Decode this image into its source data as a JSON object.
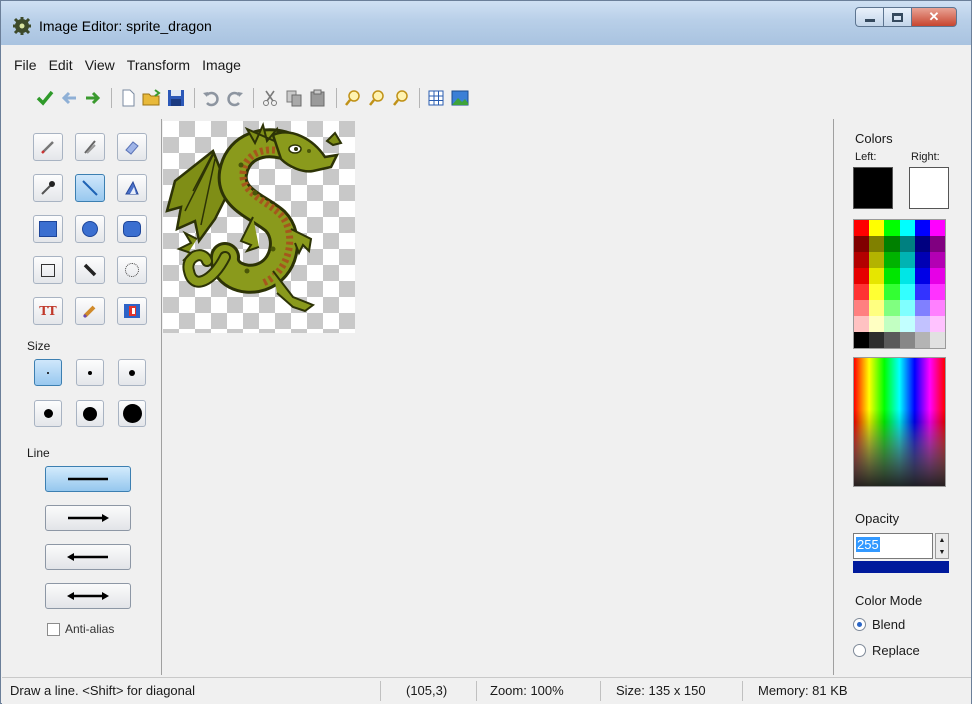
{
  "window": {
    "title": "Image Editor: sprite_dragon",
    "close_label": "✕"
  },
  "menu": [
    "File",
    "Edit",
    "View",
    "Transform",
    "Image"
  ],
  "toolbar": {
    "icons": [
      "ok-icon",
      "back-icon",
      "forward-icon",
      "new-icon",
      "open-icon",
      "save-icon",
      "undo-icon",
      "redo-icon",
      "cut-icon",
      "copy-icon",
      "paste-icon",
      "zoom-in-icon",
      "zoom-out-icon",
      "zoom-fit-icon",
      "grid-icon",
      "image-icon"
    ]
  },
  "tools": {
    "size_label": "Size",
    "line_label": "Line",
    "anti_alias_label": "Anti-alias",
    "anti_alias_checked": false,
    "text_tool_glyph": "TT"
  },
  "colors": {
    "section_label": "Colors",
    "left_label": "Left:",
    "right_label": "Right:",
    "left_color": "#000000",
    "right_color": "#ffffff"
  },
  "opacity": {
    "label": "Opacity",
    "value": "255"
  },
  "color_mode": {
    "label": "Color Mode",
    "options": [
      "Blend",
      "Replace"
    ],
    "selected": "Blend"
  },
  "status": {
    "hint": "Draw a line. <Shift> for diagonal",
    "coords": "(105,3)",
    "zoom": "Zoom: 100%",
    "size": "Size: 135 x 150",
    "memory": "Memory: 81 KB"
  }
}
